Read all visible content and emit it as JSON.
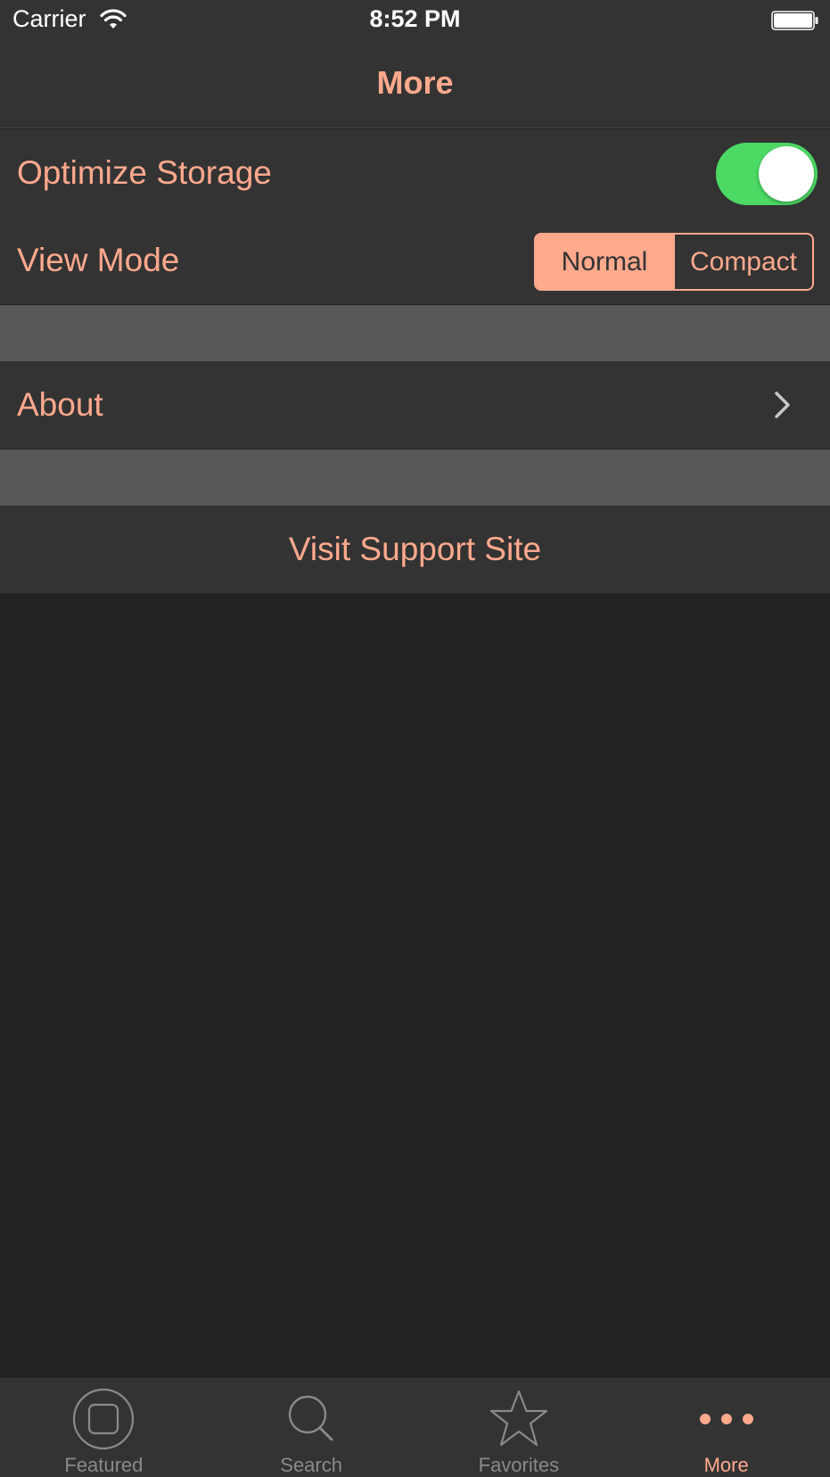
{
  "status_bar": {
    "carrier": "Carrier",
    "time": "8:52 PM",
    "wifi_icon": "wifi-icon",
    "battery_icon": "battery-icon"
  },
  "nav": {
    "title": "More"
  },
  "settings": {
    "optimize_storage": {
      "label": "Optimize Storage",
      "toggle_on": true
    },
    "view_mode": {
      "label": "View Mode",
      "options": [
        "Normal",
        "Compact"
      ],
      "selected": "Normal"
    },
    "about": {
      "label": "About",
      "accessory_icon": "chevron-right-icon"
    },
    "support": {
      "label": "Visit Support Site"
    }
  },
  "tab_bar": {
    "tabs": [
      {
        "label": "Featured",
        "icon": "featured-icon",
        "active": false
      },
      {
        "label": "Search",
        "icon": "search-icon",
        "active": false
      },
      {
        "label": "Favorites",
        "icon": "star-icon",
        "active": false
      },
      {
        "label": "More",
        "icon": "more-icon",
        "active": true
      }
    ]
  },
  "colors": {
    "accent": "#FFA98D",
    "toggle_on": "#4CD964",
    "background": "#222222",
    "cell_background": "#333333",
    "section_gap": "#575757",
    "tab_inactive": "#8A8A8A"
  }
}
